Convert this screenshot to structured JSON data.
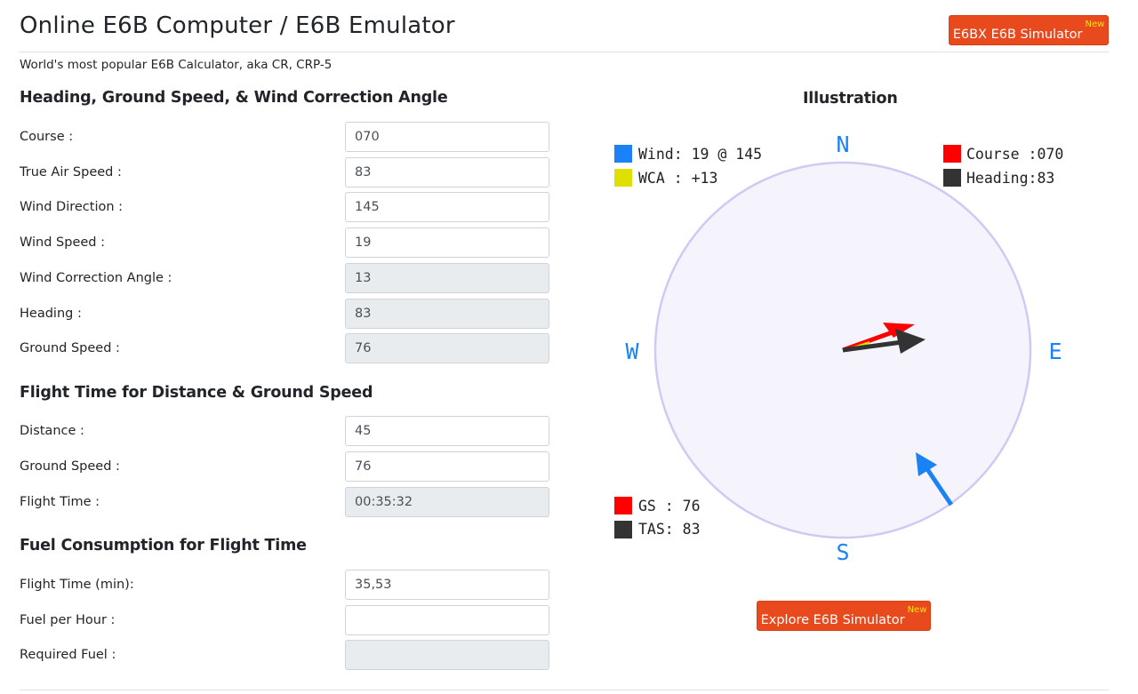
{
  "header": {
    "title": "Online E6B Computer / E6B Emulator",
    "simulator_button": "E6BX E6B Simulator",
    "simulator_badge": "New",
    "subtitle": "World's most popular E6B Calculator, aka CR, CRP-5"
  },
  "wind_section": {
    "title": "Heading, Ground Speed, & Wind Correction Angle",
    "fields": [
      {
        "label": "Course :",
        "value": "070"
      },
      {
        "label": "True Air Speed :",
        "value": "83"
      },
      {
        "label": "Wind Direction :",
        "value": "145"
      },
      {
        "label": "Wind Speed :",
        "value": "19"
      },
      {
        "label": "Wind Correction Angle :",
        "value": "13"
      },
      {
        "label": "Heading :",
        "value": "83"
      },
      {
        "label": "Ground Speed :",
        "value": "76"
      }
    ]
  },
  "time_section": {
    "title": "Flight Time for Distance & Ground Speed",
    "fields": [
      {
        "label": "Distance :",
        "value": "45"
      },
      {
        "label": "Ground Speed :",
        "value": "76"
      },
      {
        "label": "Flight Time :",
        "value": "00:35:32"
      }
    ]
  },
  "fuel_section": {
    "title": "Fuel Consumption for Flight Time",
    "fields": [
      {
        "label": "Flight Time (min):",
        "value": "35,53"
      },
      {
        "label": "Fuel per Hour :",
        "value": ""
      },
      {
        "label": "Required Fuel :",
        "value": ""
      }
    ]
  },
  "illustration": {
    "title": "Illustration",
    "compass": {
      "n": "N",
      "e": "E",
      "s": "S",
      "w": "W"
    },
    "legend_top_left": [
      "Wind: 19 @ 145",
      "WCA : +13"
    ],
    "legend_top_right": [
      "Course :070",
      "Heading:83"
    ],
    "legend_bottom_left": [
      "GS : 76",
      "TAS: 83"
    ],
    "explore_button": "Explore E6B Simulator",
    "explore_badge": "New",
    "colors": {
      "wind": "#1a82f5",
      "wca": "#e0e000",
      "course": "#ff0000",
      "heading": "#333333",
      "gs": "#ff0000",
      "tas": "#333333",
      "circle_fill": "#f5f4fd",
      "circle_stroke": "#cfcaf4",
      "compass_text": "#1a82f5"
    }
  }
}
